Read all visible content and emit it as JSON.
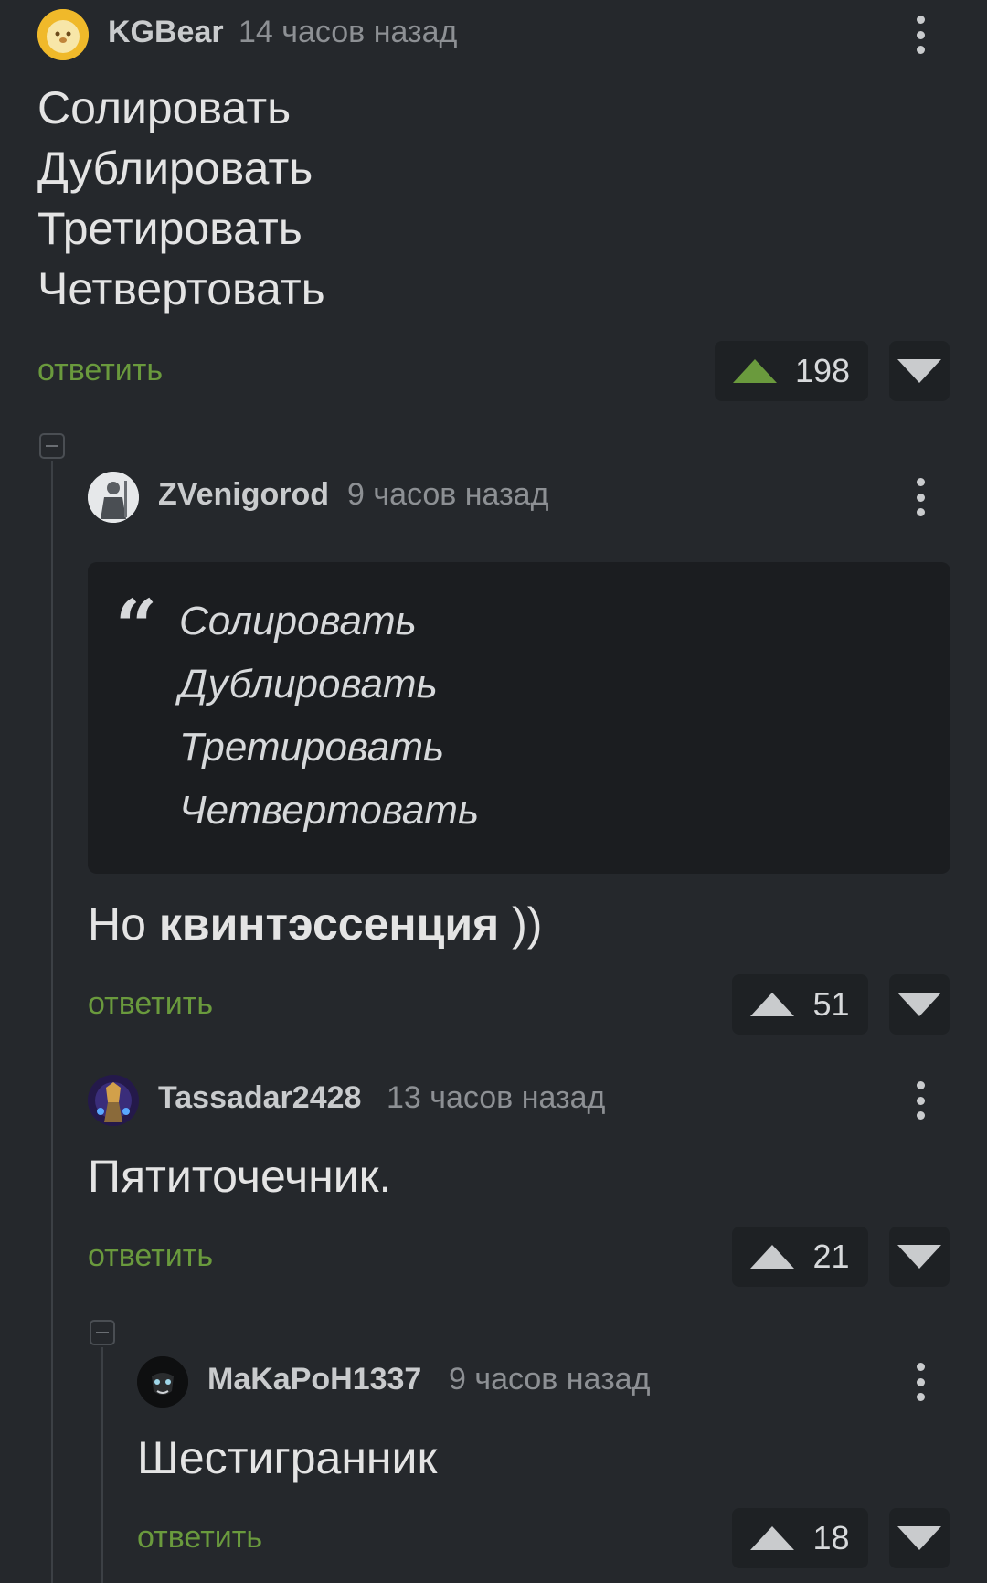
{
  "comments": [
    {
      "author": "KGBear",
      "time": "14 часов назад",
      "lines": [
        "Солировать",
        "Дублировать",
        "Третировать",
        "Четвертовать"
      ],
      "reply_label": "ответить",
      "rating": "198",
      "upvoted": true
    },
    {
      "author": "ZVenigorod",
      "time": "9 часов назад",
      "quote_lines": [
        "Солировать",
        "Дублировать",
        "Третировать",
        "Четвертовать"
      ],
      "text_prefix": "Но ",
      "text_bold": "квинтэссенция",
      "text_suffix": " ))",
      "reply_label": "ответить",
      "rating": "51"
    },
    {
      "author": "Tassadar2428",
      "time": "13 часов назад",
      "text": "Пятиточечник.",
      "reply_label": "ответить",
      "rating": "21"
    },
    {
      "author": "MaKaPoH1337",
      "time": "9 часов назад",
      "text": "Шестигранник",
      "reply_label": "ответить",
      "rating": "18"
    }
  ],
  "colors": {
    "background": "#25282c",
    "accent_green": "#6a9a3d",
    "vote_box": "#1e2124",
    "quote_bg": "#1b1d20"
  },
  "icons": [
    "more-vertical-icon",
    "upvote-arrow-icon",
    "downvote-arrow-icon",
    "collapse-thread-icon",
    "quote-icon"
  ]
}
